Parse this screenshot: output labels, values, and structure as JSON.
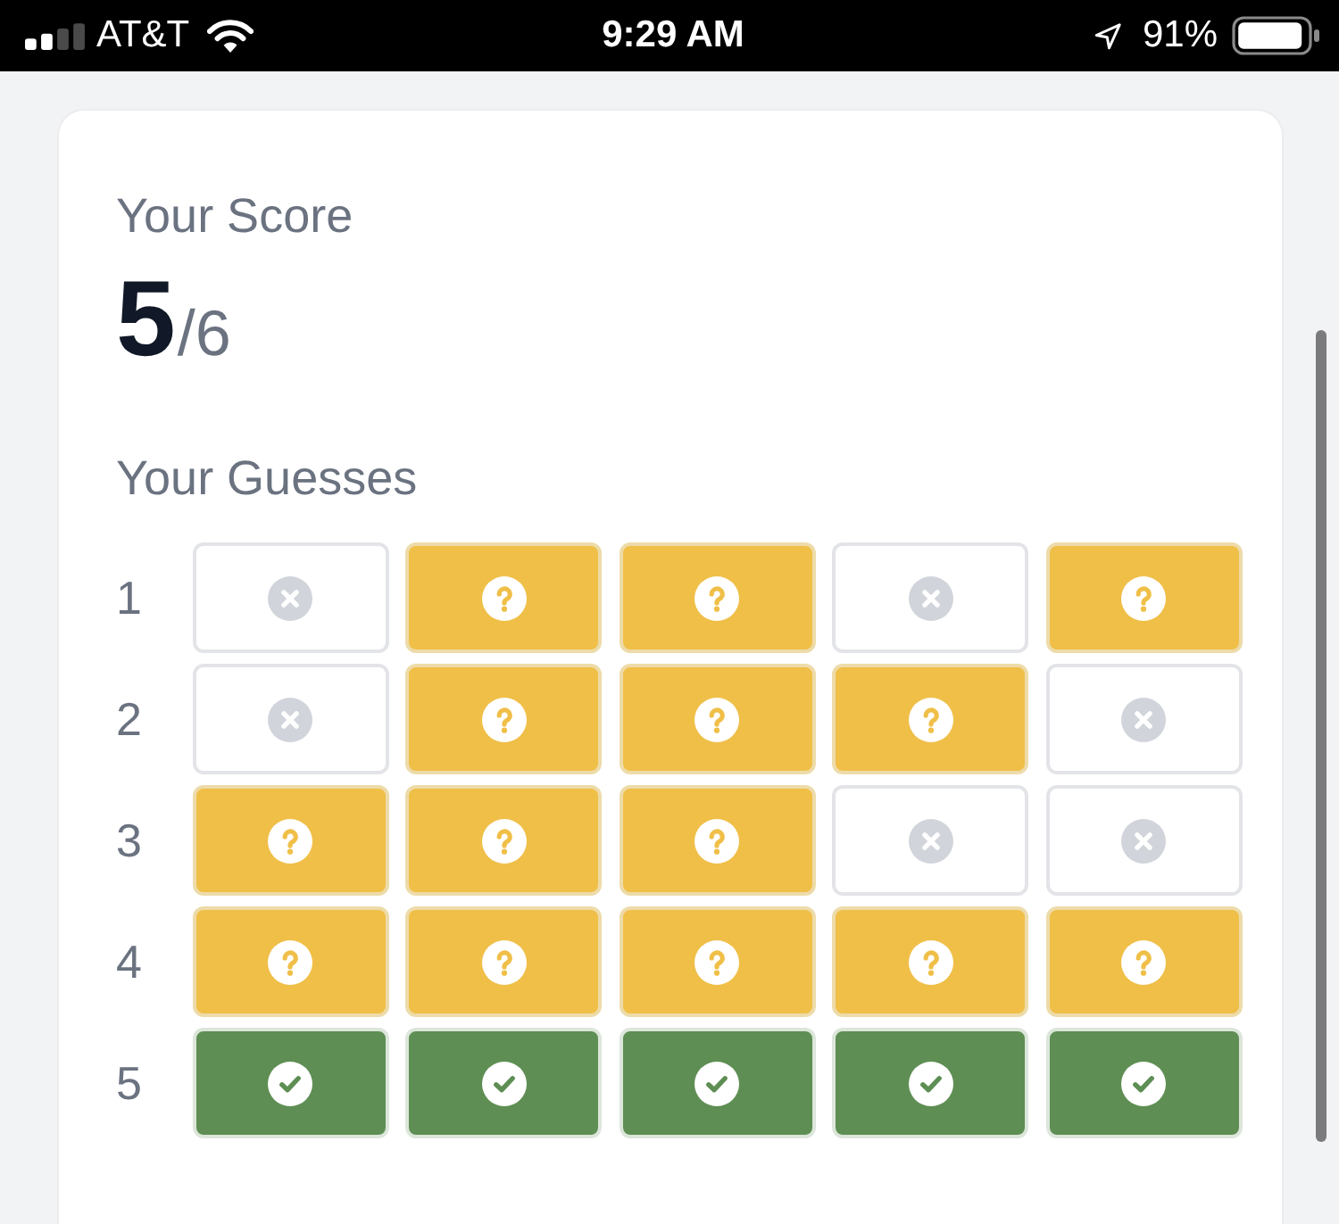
{
  "status_bar": {
    "carrier": "AT&T",
    "time": "9:29 AM",
    "battery": "91%"
  },
  "score": {
    "label": "Your Score",
    "value": "5",
    "total": "/6"
  },
  "guesses": {
    "title": "Your Guesses",
    "rows": [
      {
        "number": "1",
        "tiles": [
          {
            "kind": "absent"
          },
          {
            "kind": "present"
          },
          {
            "kind": "present"
          },
          {
            "kind": "absent"
          },
          {
            "kind": "present"
          }
        ]
      },
      {
        "number": "2",
        "tiles": [
          {
            "kind": "absent"
          },
          {
            "kind": "present"
          },
          {
            "kind": "present"
          },
          {
            "kind": "present"
          },
          {
            "kind": "absent"
          }
        ]
      },
      {
        "number": "3",
        "tiles": [
          {
            "kind": "present"
          },
          {
            "kind": "present"
          },
          {
            "kind": "present"
          },
          {
            "kind": "absent"
          },
          {
            "kind": "absent"
          }
        ]
      },
      {
        "number": "4",
        "tiles": [
          {
            "kind": "present"
          },
          {
            "kind": "present"
          },
          {
            "kind": "present"
          },
          {
            "kind": "present"
          },
          {
            "kind": "present"
          }
        ]
      },
      {
        "number": "5",
        "tiles": [
          {
            "kind": "correct"
          },
          {
            "kind": "correct"
          },
          {
            "kind": "correct"
          },
          {
            "kind": "correct"
          },
          {
            "kind": "correct"
          }
        ]
      }
    ]
  }
}
